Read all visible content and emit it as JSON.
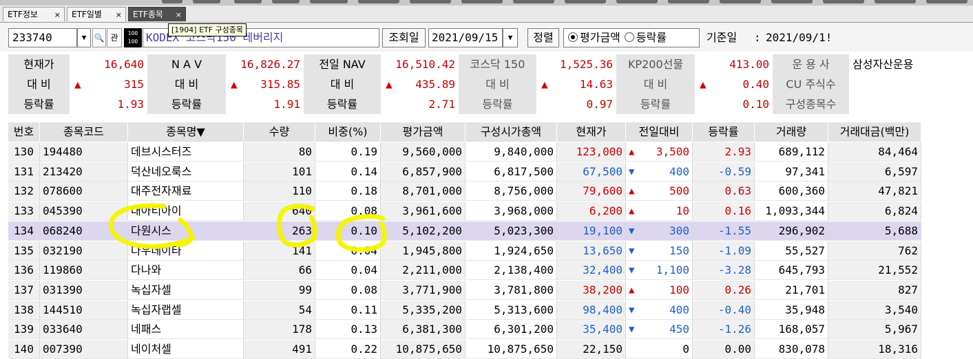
{
  "tabs": [
    {
      "label": "ETF정보",
      "close": "×"
    },
    {
      "label": "ETF일별",
      "close": "×"
    },
    {
      "label": "ETF종목",
      "close": "×"
    }
  ],
  "tooltip": "[1904] ETF 구성종목",
  "controls": {
    "code": "233740",
    "gwan_label": "관",
    "logo_text": "100 100",
    "etf_name": "KODEX 코스닥150 레버리지",
    "query_label": "조회일",
    "date": "2021/09/15",
    "sort_label": "정렬",
    "radio1": "평가금액",
    "radio2": "등락률",
    "base_label": "기준일",
    "base_colon": ":",
    "base_date": "2021/09/1!"
  },
  "summary": {
    "r1": [
      "현재가",
      "16,640",
      "N A V",
      "16,826.27",
      "전일 NAV",
      "16,510.42",
      "코스닥 150",
      "1,525.36",
      "KP200선물",
      "413.00",
      "운 용 사",
      "삼성자산운용"
    ],
    "r2": [
      "대 비",
      "315",
      "대 비",
      "315.85",
      "대 비",
      "435.89",
      "대 비",
      "14.63",
      "대 비",
      "0.40",
      "CU 주식수",
      ""
    ],
    "r3": [
      "등락률",
      "1.93",
      "등락률",
      "1.91",
      "등락률",
      "2.71",
      "등락률",
      "0.97",
      "등락률",
      "0.10",
      "구성종목수",
      ""
    ]
  },
  "table": {
    "headers": [
      "번호",
      "종목코드",
      "종목명▼",
      "수량",
      "비중(%)",
      "평가금액",
      "구성시가총액",
      "현재가",
      "전일대비",
      "등락률",
      "거래량",
      "거래대금(백만)"
    ],
    "rows": [
      {
        "no": "130",
        "code": "194480",
        "name": "데브시스터즈",
        "qty": "80",
        "weight": "0.19",
        "eval": "9,560,000",
        "mcap": "9,840,000",
        "price": "123,000",
        "dir": "up",
        "chg": "3,500",
        "rate": "2.93",
        "vol": "689,112",
        "amt": "84,464"
      },
      {
        "no": "131",
        "code": "213420",
        "name": "덕산네오룩스",
        "qty": "101",
        "weight": "0.14",
        "eval": "6,857,900",
        "mcap": "6,817,500",
        "price": "67,500",
        "dir": "down",
        "chg": "400",
        "rate": "-0.59",
        "vol": "97,341",
        "amt": "6,597"
      },
      {
        "no": "132",
        "code": "078600",
        "name": "대주전자재료",
        "qty": "110",
        "weight": "0.18",
        "eval": "8,701,000",
        "mcap": "8,756,000",
        "price": "79,600",
        "dir": "up",
        "chg": "500",
        "rate": "0.63",
        "vol": "600,360",
        "amt": "47,821"
      },
      {
        "no": "133",
        "code": "045390",
        "name": "대아티아이",
        "qty": "640",
        "weight": "0.08",
        "eval": "3,961,600",
        "mcap": "3,968,000",
        "price": "6,200",
        "dir": "up",
        "chg": "10",
        "rate": "0.16",
        "vol": "1,093,344",
        "amt": "6,824"
      },
      {
        "no": "134",
        "code": "068240",
        "name": "다원시스",
        "qty": "263",
        "weight": "0.10",
        "eval": "5,102,200",
        "mcap": "5,023,300",
        "price": "19,100",
        "dir": "down",
        "chg": "300",
        "rate": "-1.55",
        "vol": "296,902",
        "amt": "5,688"
      },
      {
        "no": "135",
        "code": "032190",
        "name": "다우데이타",
        "qty": "141",
        "weight": "0.04",
        "eval": "1,945,800",
        "mcap": "1,924,650",
        "price": "13,650",
        "dir": "down",
        "chg": "150",
        "rate": "-1.09",
        "vol": "55,527",
        "amt": "762"
      },
      {
        "no": "136",
        "code": "119860",
        "name": "다나와",
        "qty": "66",
        "weight": "0.04",
        "eval": "2,211,000",
        "mcap": "2,138,400",
        "price": "32,400",
        "dir": "down",
        "chg": "1,100",
        "rate": "-3.28",
        "vol": "645,793",
        "amt": "21,552"
      },
      {
        "no": "137",
        "code": "031390",
        "name": "녹십자셀",
        "qty": "99",
        "weight": "0.08",
        "eval": "3,771,900",
        "mcap": "3,781,800",
        "price": "38,200",
        "dir": "up",
        "chg": "100",
        "rate": "0.26",
        "vol": "21,701",
        "amt": "827"
      },
      {
        "no": "138",
        "code": "144510",
        "name": "녹십자랩셀",
        "qty": "54",
        "weight": "0.11",
        "eval": "5,335,200",
        "mcap": "5,313,600",
        "price": "98,400",
        "dir": "down",
        "chg": "400",
        "rate": "-0.40",
        "vol": "35,948",
        "amt": "3,540"
      },
      {
        "no": "139",
        "code": "033640",
        "name": "네패스",
        "qty": "178",
        "weight": "0.13",
        "eval": "6,381,300",
        "mcap": "6,301,200",
        "price": "35,400",
        "dir": "down",
        "chg": "450",
        "rate": "-1.26",
        "vol": "168,057",
        "amt": "5,967"
      },
      {
        "no": "140",
        "code": "007390",
        "name": "네이처셀",
        "qty": "491",
        "weight": "0.22",
        "eval": "10,875,650",
        "mcap": "10,875,650",
        "price": "22,150",
        "dir": "flat",
        "chg": "0",
        "rate": "0.00",
        "vol": "830,078",
        "amt": "18,316"
      }
    ]
  },
  "colors": {
    "up": "#d00000",
    "down": "#1f5fc8",
    "selected_row": "#dcd6ee",
    "annotation": "#f5f500"
  }
}
